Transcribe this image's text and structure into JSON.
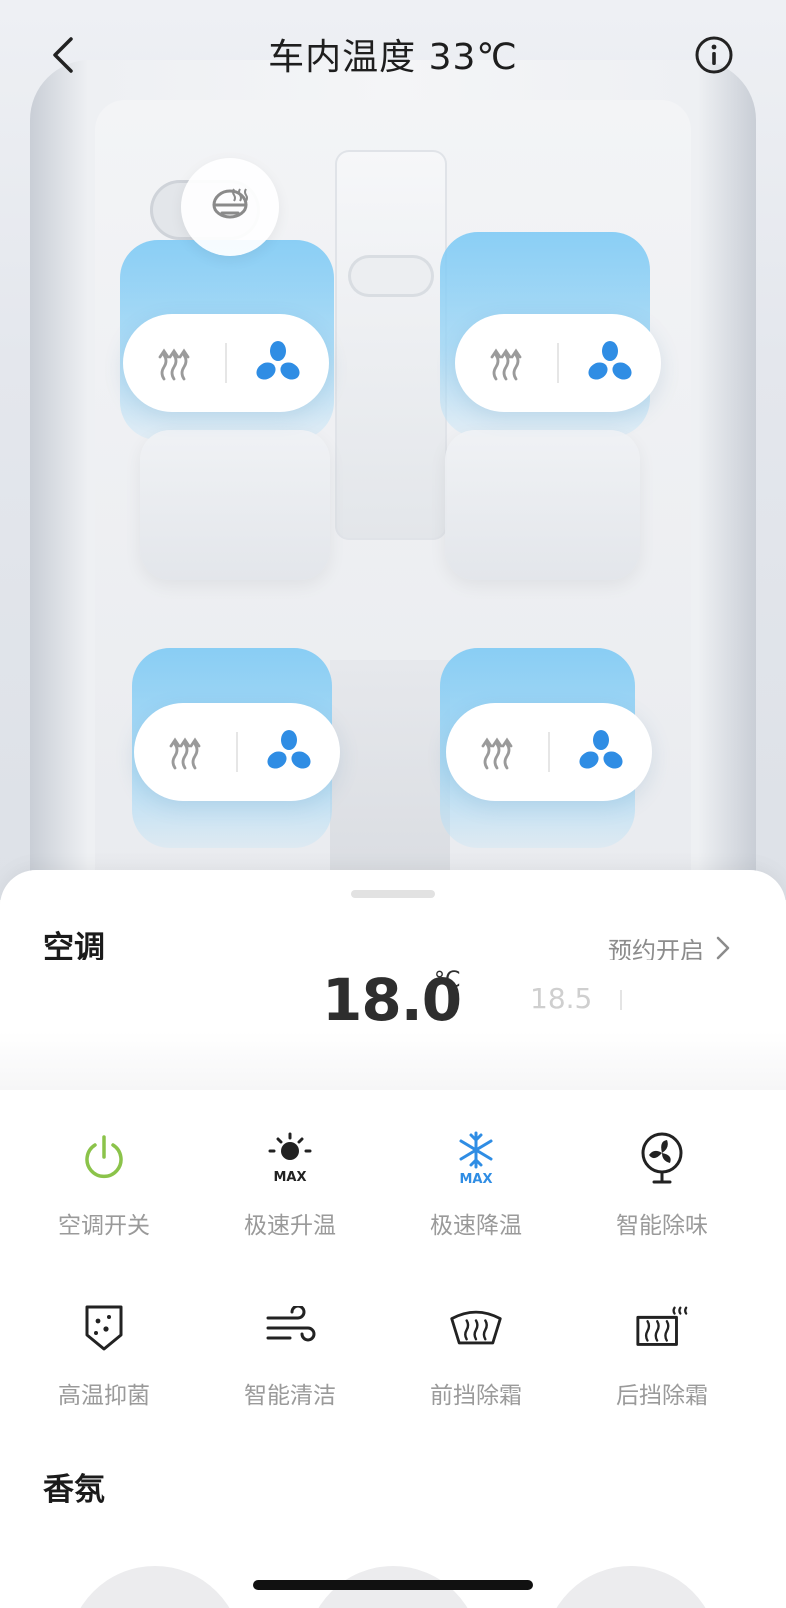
{
  "header": {
    "title": "车内温度 33℃"
  },
  "sheet": {
    "aircon_title": "空调",
    "schedule_label": "预约开启",
    "temperature": {
      "current": "18.0",
      "unit": "°C",
      "next": "18.5"
    },
    "functions": [
      {
        "label": "空调开关",
        "icon": "power-icon",
        "color": "#8bc34a"
      },
      {
        "label": "极速升温",
        "icon": "max-heat-icon",
        "color": "#222222"
      },
      {
        "label": "极速降温",
        "icon": "max-cool-icon",
        "color": "#2f8de4"
      },
      {
        "label": "智能除味",
        "icon": "fan-deodorize-icon",
        "color": "#222222"
      },
      {
        "label": "高温抑菌",
        "icon": "sterilize-shield-icon",
        "color": "#222222"
      },
      {
        "label": "智能清洁",
        "icon": "wind-clean-icon",
        "color": "#222222"
      },
      {
        "label": "前挡除霜",
        "icon": "front-defrost-icon",
        "color": "#222222"
      },
      {
        "label": "后挡除霜",
        "icon": "rear-defrost-icon",
        "color": "#222222"
      }
    ],
    "scent_title": "香氛"
  },
  "seats": [
    {
      "position": "front-left",
      "heat_icon": "seat-heat-icon",
      "vent_icon": "seat-vent-icon"
    },
    {
      "position": "front-right",
      "heat_icon": "seat-heat-icon",
      "vent_icon": "seat-vent-icon"
    },
    {
      "position": "rear-left",
      "heat_icon": "seat-heat-icon",
      "vent_icon": "seat-vent-icon"
    },
    {
      "position": "rear-right",
      "heat_icon": "seat-heat-icon",
      "vent_icon": "seat-vent-icon"
    }
  ],
  "colors": {
    "accent_blue": "#2f8de4",
    "power_green": "#8bc34a",
    "seat_highlight": "#8fd0f5"
  }
}
